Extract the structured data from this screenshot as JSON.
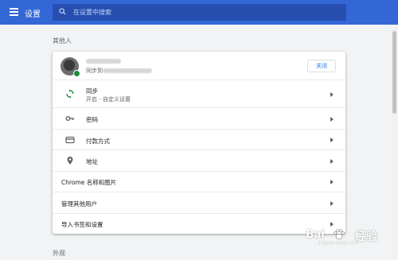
{
  "header": {
    "title": "设置",
    "search_placeholder": "在设置中搜索"
  },
  "sections": {
    "people_label": "其他人",
    "appearance_label": "外观"
  },
  "profile": {
    "name": "",
    "account_prefix": "同步到",
    "close_label": "关闭"
  },
  "rows": {
    "sync": {
      "label": "同步",
      "sublabel": "开启 - 自定义设置",
      "icon": "sync-icon"
    },
    "passwords": {
      "label": "密码",
      "icon": "key-icon"
    },
    "payment": {
      "label": "付款方式",
      "icon": "credit-card-icon"
    },
    "addresses": {
      "label": "地址",
      "icon": "location-pin-icon"
    },
    "chrome_name": {
      "label": "Chrome 名称和图片"
    },
    "manage_people": {
      "label": "管理其他用户"
    },
    "import": {
      "label": "导入书签和设置"
    }
  },
  "watermark": {
    "brand": "Bai",
    "suffix": "经验",
    "url": "jingyan.baidu.com"
  },
  "colors": {
    "header_bg": "#3367d6",
    "accent": "#1a73e8",
    "sync_green": "#1e8e3e",
    "page_bg": "#f1f3f4"
  }
}
